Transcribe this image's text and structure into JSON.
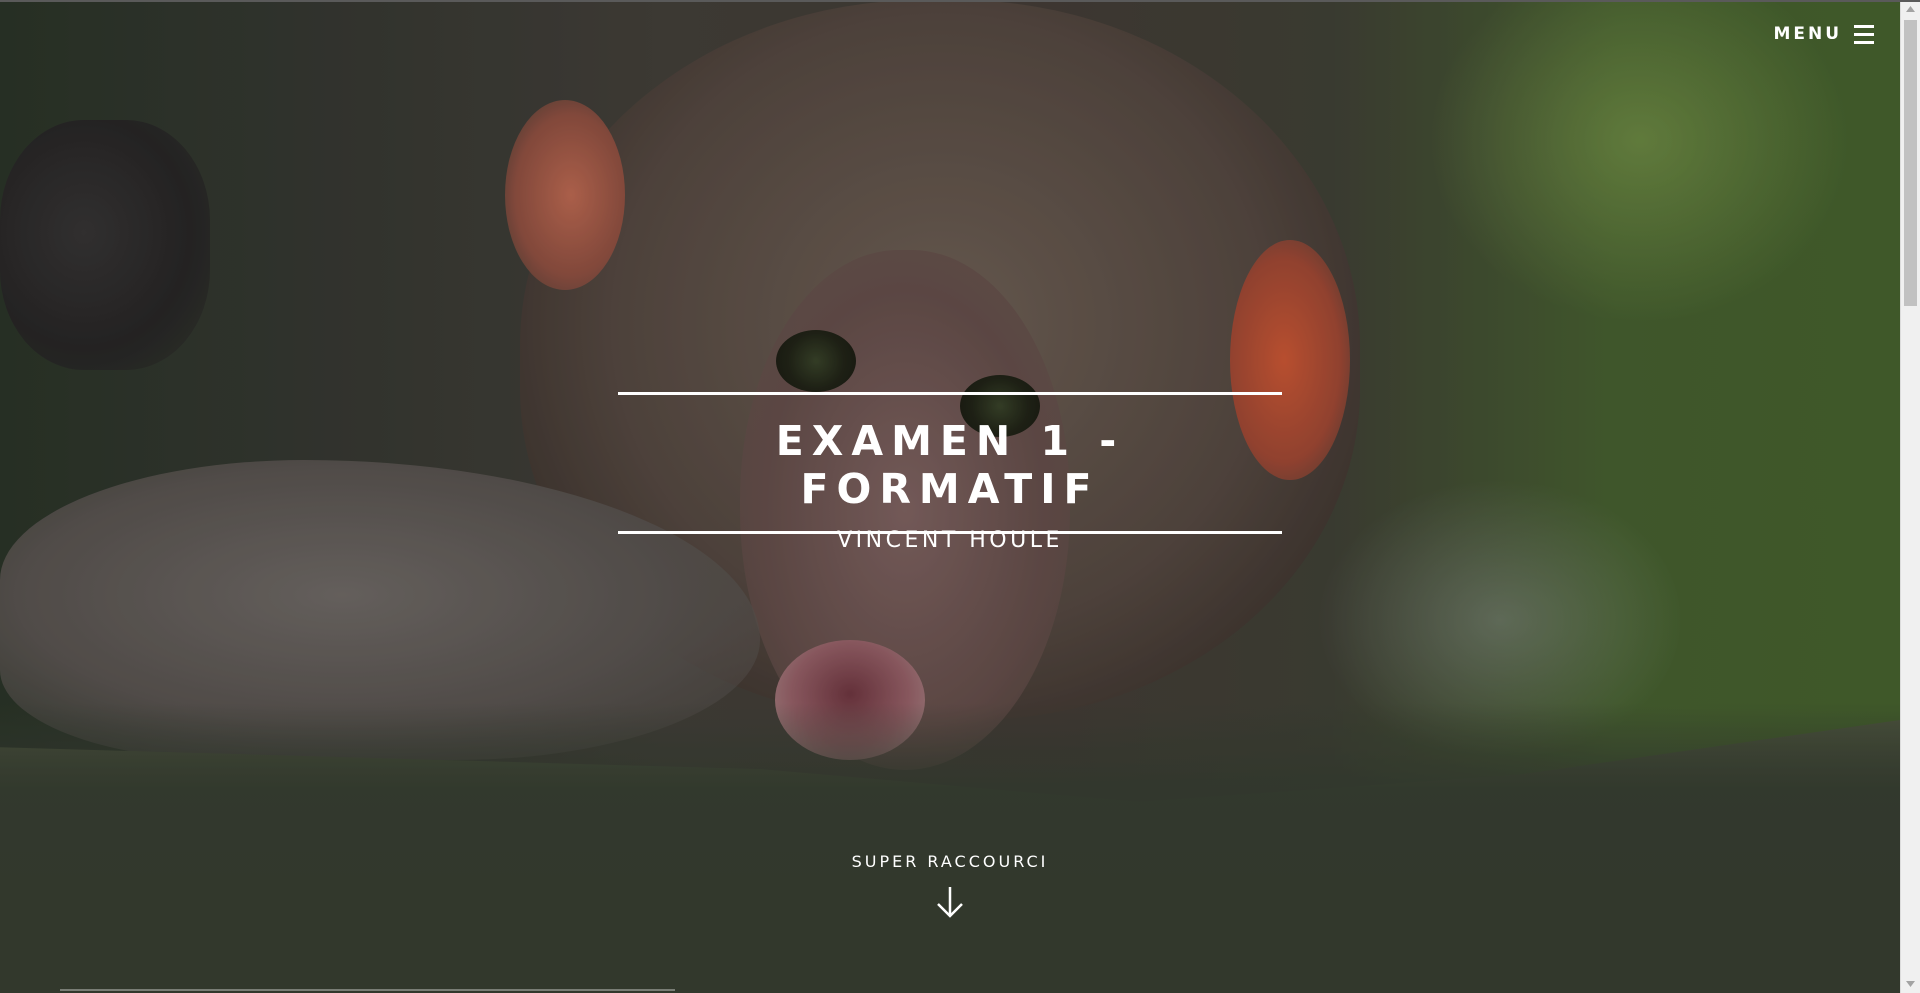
{
  "menu": {
    "label": "MENU",
    "icon": "hamburger-icon"
  },
  "hero": {
    "title": "EXAMEN 1 - FORMATIF",
    "subtitle": "VINCENT HOULE",
    "background_image": "baby-monkey-photo"
  },
  "shortcut": {
    "label": "SUPER RACCOURCI",
    "icon": "arrow-down-icon"
  },
  "colors": {
    "text": "#ffffff",
    "scrollbar_track": "#f0f0f0",
    "scrollbar_thumb": "#c1c1c1"
  }
}
